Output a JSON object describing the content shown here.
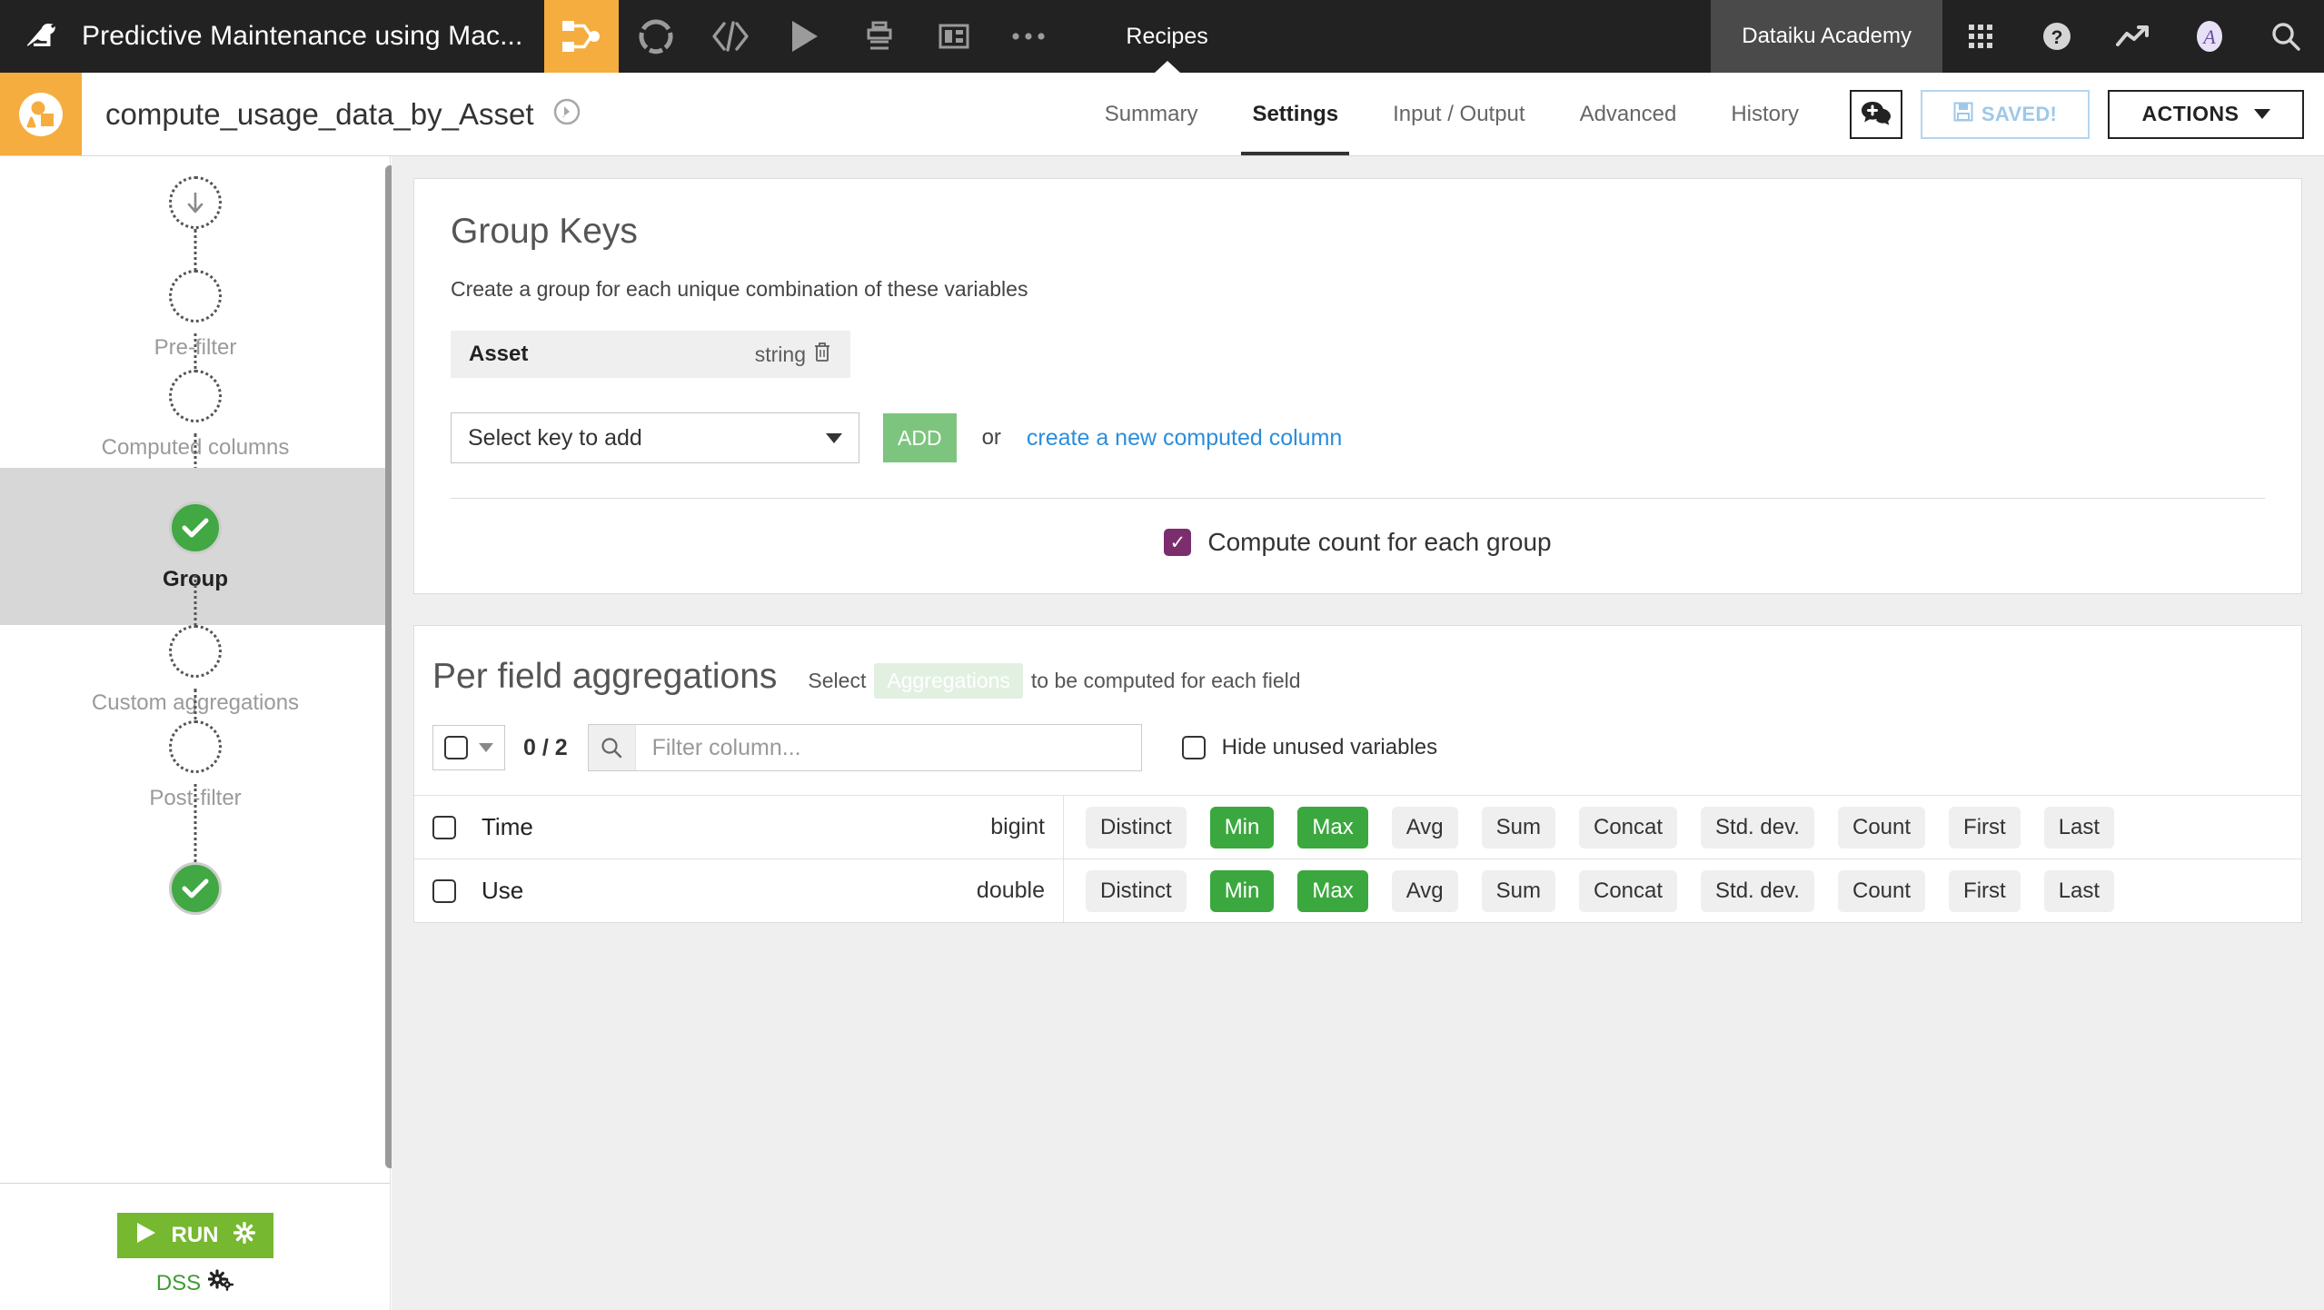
{
  "topbar": {
    "logo_icon": "dataiku-bird-logo",
    "project_title": "Predictive Maintenance using Mac...",
    "icons": [
      {
        "name": "recipe-flow-icon",
        "active": true
      },
      {
        "name": "lab-wheel-icon",
        "active": false
      },
      {
        "name": "code-icon",
        "active": false
      },
      {
        "name": "play-icon",
        "active": false
      },
      {
        "name": "jobs-icon",
        "active": false
      },
      {
        "name": "dashboard-icon",
        "active": false
      },
      {
        "name": "more-ellipsis-icon",
        "active": false
      }
    ],
    "section_label": "Recipes",
    "account_label": "Dataiku Academy",
    "right_icons": [
      {
        "name": "apps-grid-icon"
      },
      {
        "name": "help-question-icon"
      },
      {
        "name": "trending-up-icon"
      },
      {
        "name": "user-avatar-icon"
      },
      {
        "name": "search-icon"
      }
    ]
  },
  "subheader": {
    "recipe_type_icon": "group-recipe-icon",
    "recipe_name": "compute_usage_data_by_Asset",
    "recipe_status_icon": "recipe-engine-icon",
    "tabs": [
      {
        "label": "Summary",
        "active": false
      },
      {
        "label": "Settings",
        "active": true
      },
      {
        "label": "Input / Output",
        "active": false
      },
      {
        "label": "Advanced",
        "active": false
      },
      {
        "label": "History",
        "active": false
      }
    ],
    "discussions_icon": "discussion-add-icon",
    "saved_label": "SAVED!",
    "saved_icon": "floppy-disk-icon",
    "actions_label": "ACTIONS"
  },
  "sidebar": {
    "steps": [
      {
        "label": "",
        "state": "input",
        "icon": "arrow-down-icon"
      },
      {
        "label": "Pre-filter",
        "state": "empty"
      },
      {
        "label": "Computed columns",
        "state": "empty"
      },
      {
        "label": "Group",
        "state": "done",
        "active": true
      },
      {
        "label": "Custom aggregations",
        "state": "empty"
      },
      {
        "label": "Post-filter",
        "state": "empty"
      },
      {
        "label": "",
        "state": "done"
      }
    ],
    "run_label": "RUN",
    "run_icon": "play-triangle-icon",
    "run_gear_icon": "gear-icon",
    "engine_label": "DSS",
    "engine_icon": "gears-icon"
  },
  "group_keys": {
    "title": "Group Keys",
    "subtitle": "Create a group for each unique combination of these variables",
    "keys": [
      {
        "name": "Asset",
        "type": "string",
        "delete_icon": "trash-icon"
      }
    ],
    "select_placeholder": "Select key to add",
    "add_label": "ADD",
    "or_label": "or",
    "create_link": "create a new computed column",
    "compute_count_label": "Compute count for each group",
    "compute_count_checked": true
  },
  "aggregations": {
    "title": "Per field aggregations",
    "hint_prefix": "Select",
    "hint_pill": "Aggregations",
    "hint_suffix": "to be computed for each field",
    "selected_count": "0 / 2",
    "filter_placeholder": "Filter column...",
    "filter_icon": "search-icon",
    "hide_unused_label": "Hide unused variables",
    "hide_unused_checked": false,
    "agg_options": [
      "Distinct",
      "Min",
      "Max",
      "Avg",
      "Sum",
      "Concat",
      "Std. dev.",
      "Count",
      "First",
      "Last"
    ],
    "rows": [
      {
        "column": "Time",
        "type": "bigint",
        "checked": false,
        "enabled": [
          "Min",
          "Max"
        ]
      },
      {
        "column": "Use",
        "type": "double",
        "checked": false,
        "enabled": [
          "Min",
          "Max"
        ]
      }
    ]
  },
  "colors": {
    "brand_orange": "#f5ad3f",
    "topbar_dark": "#222222",
    "green_active": "#3aa83e",
    "run_green": "#76b830",
    "link_blue": "#2b8ddb",
    "purple_check": "#7b2d6d",
    "add_green": "#7dc47e"
  }
}
